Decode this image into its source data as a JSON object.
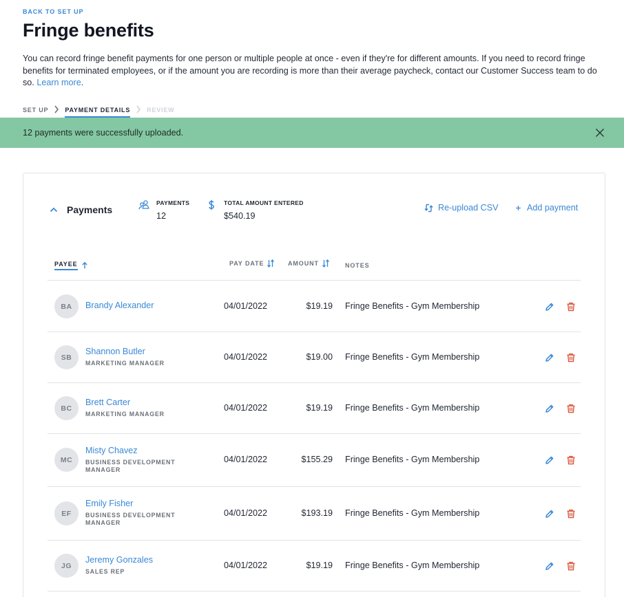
{
  "nav": {
    "back_label": "BACK TO SET UP"
  },
  "page": {
    "title": "Fringe benefits",
    "intro_text": "You can record fringe benefit payments for one person or multiple people at once - even if they're for different amounts. If you need to record fringe benefits for terminated employees, or if the amount you are recording is more than their average paycheck, contact our Customer Success team to do so.",
    "learn_more": "Learn more",
    "intro_end": "."
  },
  "steps": [
    {
      "label": "SET UP",
      "state": "done"
    },
    {
      "label": "PAYMENT DETAILS",
      "state": "active"
    },
    {
      "label": "REVIEW",
      "state": "upcoming"
    }
  ],
  "banner": {
    "message": "12 payments were successfully uploaded.",
    "color": "#84c8a3"
  },
  "summary": {
    "title": "Payments",
    "payments_label": "PAYMENTS",
    "payments_value": "12",
    "total_label": "TOTAL AMOUNT ENTERED",
    "total_value": "$540.19",
    "reupload_label": "Re-upload CSV",
    "add_label": "Add payment"
  },
  "table": {
    "columns": {
      "payee": "PAYEE",
      "pay_date": "PAY DATE",
      "amount": "AMOUNT",
      "notes": "NOTES"
    },
    "rows": [
      {
        "initials": "BA",
        "name": "Brandy Alexander",
        "title": "",
        "date": "04/01/2022",
        "amount": "$19.19",
        "notes": "Fringe Benefits - Gym Membership"
      },
      {
        "initials": "SB",
        "name": "Shannon Butler",
        "title": "MARKETING MANAGER",
        "date": "04/01/2022",
        "amount": "$19.00",
        "notes": "Fringe Benefits - Gym Membership"
      },
      {
        "initials": "BC",
        "name": "Brett Carter",
        "title": "MARKETING MANAGER",
        "date": "04/01/2022",
        "amount": "$19.19",
        "notes": "Fringe Benefits - Gym Membership"
      },
      {
        "initials": "MC",
        "name": "Misty Chavez",
        "title": "BUSINESS DEVELOPMENT MANAGER",
        "date": "04/01/2022",
        "amount": "$155.29",
        "notes": "Fringe Benefits - Gym Membership"
      },
      {
        "initials": "EF",
        "name": "Emily Fisher",
        "title": "BUSINESS DEVELOPMENT MANAGER",
        "date": "04/01/2022",
        "amount": "$193.19",
        "notes": "Fringe Benefits - Gym Membership"
      },
      {
        "initials": "JG",
        "name": "Jeremy Gonzales",
        "title": "SALES REP",
        "date": "04/01/2022",
        "amount": "$19.19",
        "notes": "Fringe Benefits - Gym Membership"
      }
    ]
  },
  "colors": {
    "accent": "#3a88d6",
    "delete": "#d9553a"
  }
}
